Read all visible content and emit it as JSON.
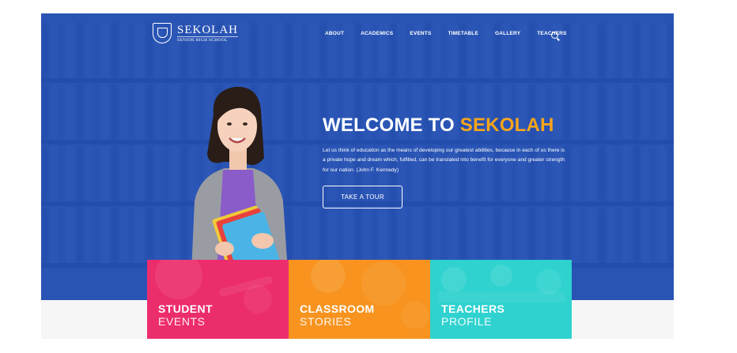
{
  "brand": {
    "name": "SEKOLAH",
    "tagline": "SENIOR HIGH SCHOOL"
  },
  "nav": {
    "items": [
      {
        "label": "ABOUT"
      },
      {
        "label": "ACADEMICS"
      },
      {
        "label": "EVENTS"
      },
      {
        "label": "TIMETABLE"
      },
      {
        "label": "GALLERY"
      },
      {
        "label": "TEACHERS"
      }
    ],
    "search_icon": "search-icon"
  },
  "hero": {
    "title_prefix": "WELCOME TO ",
    "title_accent": "SEKOLAH",
    "text": "Let us think of education as the means of developing our greatest abilities, because in each of us there is a private hope and dream which, fulfilled, can be translated into benefit for everyone and greater strength for our nation. (John F. Kennedy)",
    "cta_label": "TAKE A TOUR"
  },
  "cards": [
    {
      "title": "STUDENT",
      "subtitle": "EVENTS",
      "color": "#ec2d6c"
    },
    {
      "title": "CLASSROOM",
      "subtitle": "STORIES",
      "color": "#f7931e"
    },
    {
      "title": "TEACHERS",
      "subtitle": "PROFILE",
      "color": "#2fd2cf"
    }
  ],
  "colors": {
    "hero_blue": "#2a55b4",
    "accent_orange": "#f8a51b"
  }
}
